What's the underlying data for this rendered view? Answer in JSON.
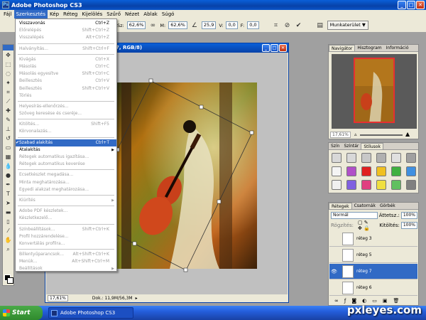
{
  "window": {
    "title": "Adobe Photoshop CS3"
  },
  "menubar": {
    "items": [
      "Fájl",
      "Szerkesztés",
      "Kép",
      "Réteg",
      "Kijelölés",
      "Szűrő",
      "Nézet",
      "Ablak",
      "Súgó"
    ]
  },
  "options": {
    "w_label": "Sz:",
    "w_value": "62,6%",
    "h_label": "M:",
    "h_value": "62,6%",
    "angle": "25,9",
    "hskew_label": "V:",
    "hskew_value": "0,0",
    "vskew_label": "F:",
    "vskew_value": "0,0",
    "workspace": "Munkaterület ▼"
  },
  "edit_menu": [
    {
      "label": "Visszavonás",
      "shortcut": "Ctrl+Z",
      "disabled": false
    },
    {
      "label": "Előrelépés",
      "shortcut": "Shift+Ctrl+Z",
      "disabled": true
    },
    {
      "label": "Visszalépés",
      "shortcut": "Alt+Ctrl+Z",
      "disabled": true
    },
    {
      "sep": true
    },
    {
      "label": "Halványítás...",
      "shortcut": "Shift+Ctrl+F",
      "disabled": true
    },
    {
      "sep": true
    },
    {
      "label": "Kivágás",
      "shortcut": "Ctrl+X",
      "disabled": true
    },
    {
      "label": "Másolás",
      "shortcut": "Ctrl+C",
      "disabled": true
    },
    {
      "label": "Másolás egyesítve",
      "shortcut": "Shift+Ctrl+C",
      "disabled": true
    },
    {
      "label": "Beillesztés",
      "shortcut": "Ctrl+V",
      "disabled": true
    },
    {
      "label": "Beillesztés",
      "shortcut": "Shift+Ctrl+V",
      "disabled": true
    },
    {
      "label": "Törlés",
      "shortcut": "",
      "disabled": true
    },
    {
      "sep": true
    },
    {
      "label": "Helyesírás-ellenőrzés...",
      "shortcut": "",
      "disabled": true
    },
    {
      "label": "Szöveg keresése és cseréje...",
      "shortcut": "",
      "disabled": true
    },
    {
      "sep": true
    },
    {
      "label": "Kitöltés...",
      "shortcut": "Shift+F5",
      "disabled": true
    },
    {
      "label": "Körvonalazás...",
      "shortcut": "",
      "disabled": true
    },
    {
      "sep": true
    },
    {
      "label": "Szabad alakítás",
      "shortcut": "Ctrl+T",
      "disabled": false,
      "highlight": true,
      "checked": true
    },
    {
      "label": "Átalakítás",
      "shortcut": "",
      "disabled": false,
      "submenu": true
    },
    {
      "label": "Rétegek automatikus igazítása...",
      "shortcut": "",
      "disabled": true
    },
    {
      "label": "Rétegek automatikus keverése",
      "shortcut": "",
      "disabled": true
    },
    {
      "sep": true
    },
    {
      "label": "Ecsetkészlet megadása...",
      "shortcut": "",
      "disabled": true
    },
    {
      "label": "Minta meghatározása...",
      "shortcut": "",
      "disabled": true
    },
    {
      "label": "Egyedi alakzat meghatározása...",
      "shortcut": "",
      "disabled": true
    },
    {
      "sep": true
    },
    {
      "label": "Kiürítés",
      "shortcut": "",
      "disabled": true,
      "submenu": true
    },
    {
      "sep": true
    },
    {
      "label": "Adobe PDF készletek...",
      "shortcut": "",
      "disabled": true
    },
    {
      "label": "Készletkezelő...",
      "shortcut": "",
      "disabled": true
    },
    {
      "sep": true
    },
    {
      "label": "Színbeállítások...",
      "shortcut": "Shift+Ctrl+K",
      "disabled": true
    },
    {
      "label": "Profil hozzárendelése...",
      "shortcut": "",
      "disabled": true
    },
    {
      "label": "Konvertálás profilra...",
      "shortcut": "",
      "disabled": true
    },
    {
      "sep": true
    },
    {
      "label": "Billentyűparancsok...",
      "shortcut": "Alt+Shift+Ctrl+K",
      "disabled": true
    },
    {
      "label": "Menük...",
      "shortcut": "Alt+Shift+Ctrl+M",
      "disabled": true
    },
    {
      "label": "Beállítások",
      "shortcut": "",
      "disabled": true,
      "submenu": true
    }
  ],
  "document": {
    "title_suffix": "7, RGB/8)",
    "zoom": "17,61%",
    "doc_size": "Dok.: 11,9M/56,3M"
  },
  "navigator": {
    "tabs": [
      "Navigátor",
      "Hisztogram",
      "Információ"
    ],
    "zoom": "17,61%"
  },
  "styles_panel": {
    "tabs": [
      "Szín",
      "Színtár",
      "Stílusok"
    ],
    "swatch_colors": [
      "#d8d8d8",
      "#d8d8d8",
      "#c8c8c8",
      "#b0b0b0",
      "#e0e0e0",
      "#a0a0a0",
      "#f4f4f4",
      "#b04fc8",
      "#e02020",
      "#f0c020",
      "#40b040",
      "#4090e0",
      "#f0f0f0",
      "#8060e0",
      "#e04080",
      "#f0e040",
      "#60c060",
      "#808080"
    ]
  },
  "layers": {
    "tabs": [
      "Rétegek",
      "Csatornák",
      "Görbék"
    ],
    "blend_mode": "Normál",
    "opacity_label": "Áttetsz.:",
    "opacity_value": "100%",
    "lock_label": "Rögzítés:",
    "fill_label": "Kitöltés:",
    "fill_value": "100%",
    "items": [
      {
        "name": "réteg 3",
        "visible": false,
        "selected": false
      },
      {
        "name": "réteg 5",
        "visible": false,
        "selected": false
      },
      {
        "name": "réteg 7",
        "visible": true,
        "selected": true
      },
      {
        "name": "réteg 6",
        "visible": false,
        "selected": false
      }
    ]
  },
  "taskbar": {
    "start": "Start",
    "task": "Adobe Photoshop CS3"
  },
  "watermark": "pxleyes.com",
  "colors": {
    "accent": "#316ac5",
    "xp_blue": "#0842a8"
  }
}
